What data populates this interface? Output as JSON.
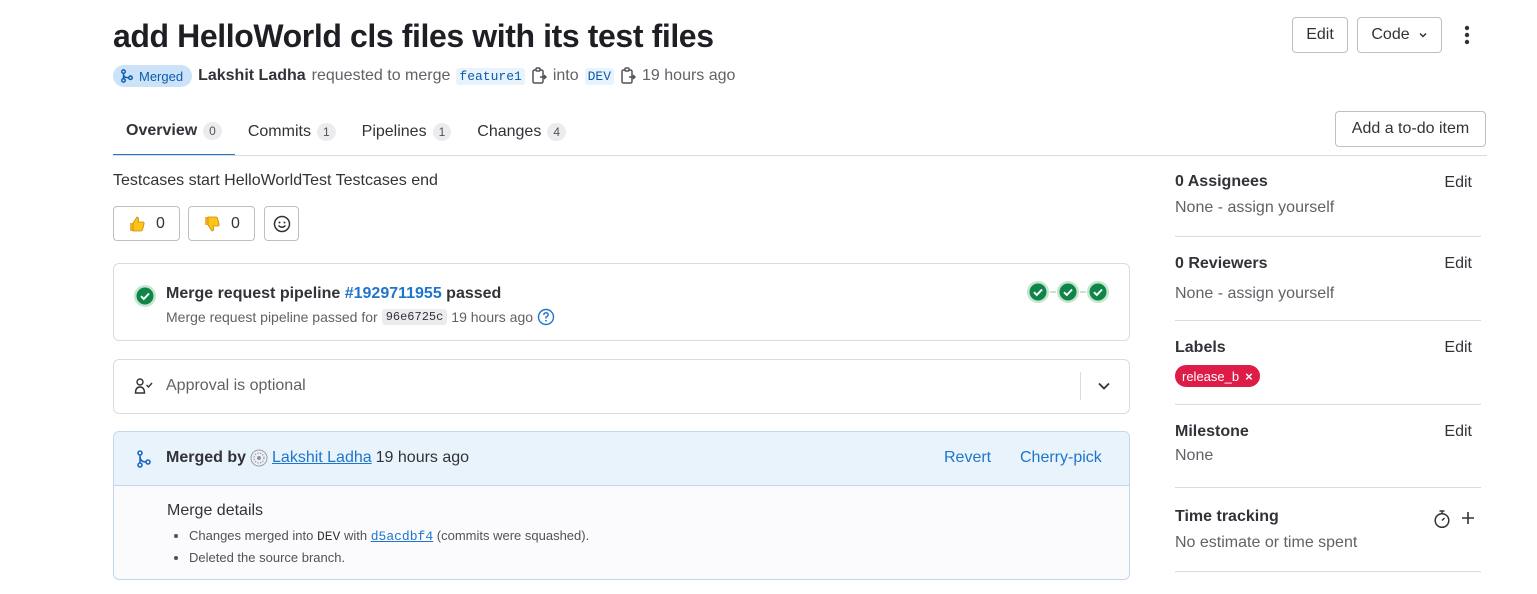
{
  "header": {
    "title": "add HelloWorld cls files with its test files",
    "status_badge": "Merged",
    "author": "Lakshit Ladha",
    "requested_text": "requested to merge",
    "source_branch": "feature1",
    "into_text": "into",
    "target_branch": "DEV",
    "time": "19 hours ago",
    "edit_label": "Edit",
    "code_label": "Code"
  },
  "tabs": [
    {
      "label": "Overview",
      "count": "0"
    },
    {
      "label": "Commits",
      "count": "1"
    },
    {
      "label": "Pipelines",
      "count": "1"
    },
    {
      "label": "Changes",
      "count": "4"
    }
  ],
  "todo_button": "Add a to-do item",
  "description": "Testcases start HelloWorldTest Testcases end",
  "reactions": {
    "thumbs_up_count": "0",
    "thumbs_down_count": "0"
  },
  "pipeline": {
    "title_prefix": "Merge request pipeline",
    "pipeline_id": "#1929711955",
    "status": "passed",
    "sub_prefix": "Merge request pipeline passed for",
    "sha": "96e6725c",
    "time": "19 hours ago"
  },
  "approval": {
    "text": "Approval is optional"
  },
  "merged": {
    "prefix": "Merged by",
    "user": "Lakshit Ladha",
    "time": "19 hours ago",
    "revert_label": "Revert",
    "cherry_pick_label": "Cherry-pick",
    "details_title": "Merge details",
    "detail1_prefix": "Changes merged into",
    "detail1_branch": "DEV",
    "detail1_with": "with",
    "detail1_commit": "d5acdbf4",
    "detail1_suffix": "(commits were squashed).",
    "detail2": "Deleted the source branch."
  },
  "sidebar": {
    "assignees": {
      "title": "0 Assignees",
      "edit": "Edit",
      "value": "None - assign yourself"
    },
    "reviewers": {
      "title": "0 Reviewers",
      "edit": "Edit",
      "value": "None - assign yourself"
    },
    "labels": {
      "title": "Labels",
      "edit": "Edit",
      "label": "release_b",
      "label_color": "#dd1c47"
    },
    "milestone": {
      "title": "Milestone",
      "edit": "Edit",
      "value": "None"
    },
    "time_tracking": {
      "title": "Time tracking",
      "value": "No estimate or time spent"
    }
  },
  "colors": {
    "accent": "#1f75cb",
    "success": "#108548",
    "merged_badge_bg": "#cbe2f9"
  }
}
